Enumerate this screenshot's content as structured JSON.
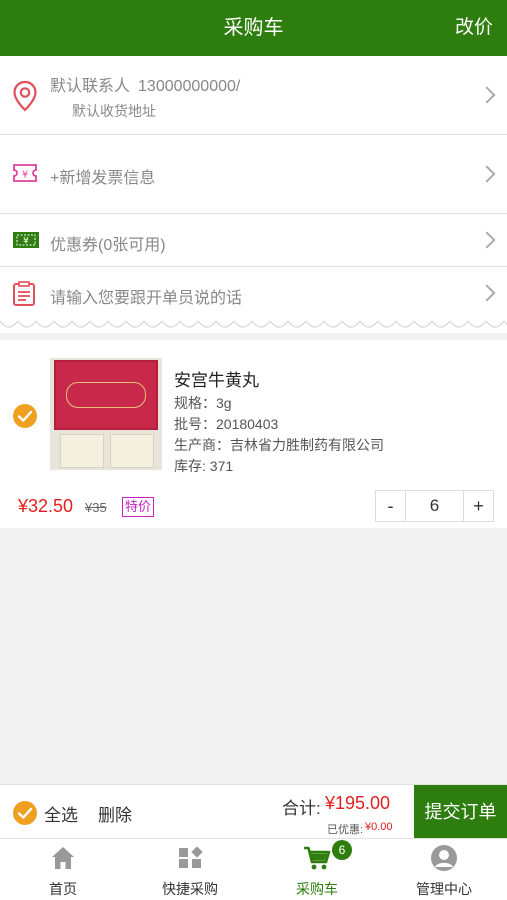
{
  "header": {
    "title": "采购车",
    "action": "改价"
  },
  "contact": {
    "name": "默认联系人",
    "phone": "13000000000/",
    "address": "默认收货地址"
  },
  "invoice": {
    "label": "+新增发票信息"
  },
  "coupon": {
    "label": "优惠券(0张可用)"
  },
  "message": {
    "placeholder": "请输入您要跟开单员说的话"
  },
  "product": {
    "name": "安宫牛黄丸",
    "spec": "规格：3g",
    "batch": "批号：20180403",
    "maker": "生产商：吉林省力胜制药有限公司",
    "stock": "库存: 371",
    "price": "¥32.50",
    "original_price": "¥35",
    "badge": "特价",
    "quantity": "6",
    "minus": "-",
    "plus": "+",
    "selected": true
  },
  "bottom": {
    "select_all": "全选",
    "delete": "删除",
    "total_label": "合计:",
    "total_value": "¥195.00",
    "discount_label": "已优惠:",
    "discount_value": "¥0.00",
    "submit": "提交订单"
  },
  "tabs": [
    {
      "label": "首页",
      "icon": "home-icon"
    },
    {
      "label": "快捷采购",
      "icon": "grid-icon"
    },
    {
      "label": "采购车",
      "icon": "cart-icon",
      "badge": "6",
      "active": true
    },
    {
      "label": "管理中心",
      "icon": "user-icon"
    }
  ],
  "colors": {
    "brand": "#2e7d0f",
    "price": "#e02020",
    "check": "#f0a020",
    "badge": "#c71fc0"
  }
}
